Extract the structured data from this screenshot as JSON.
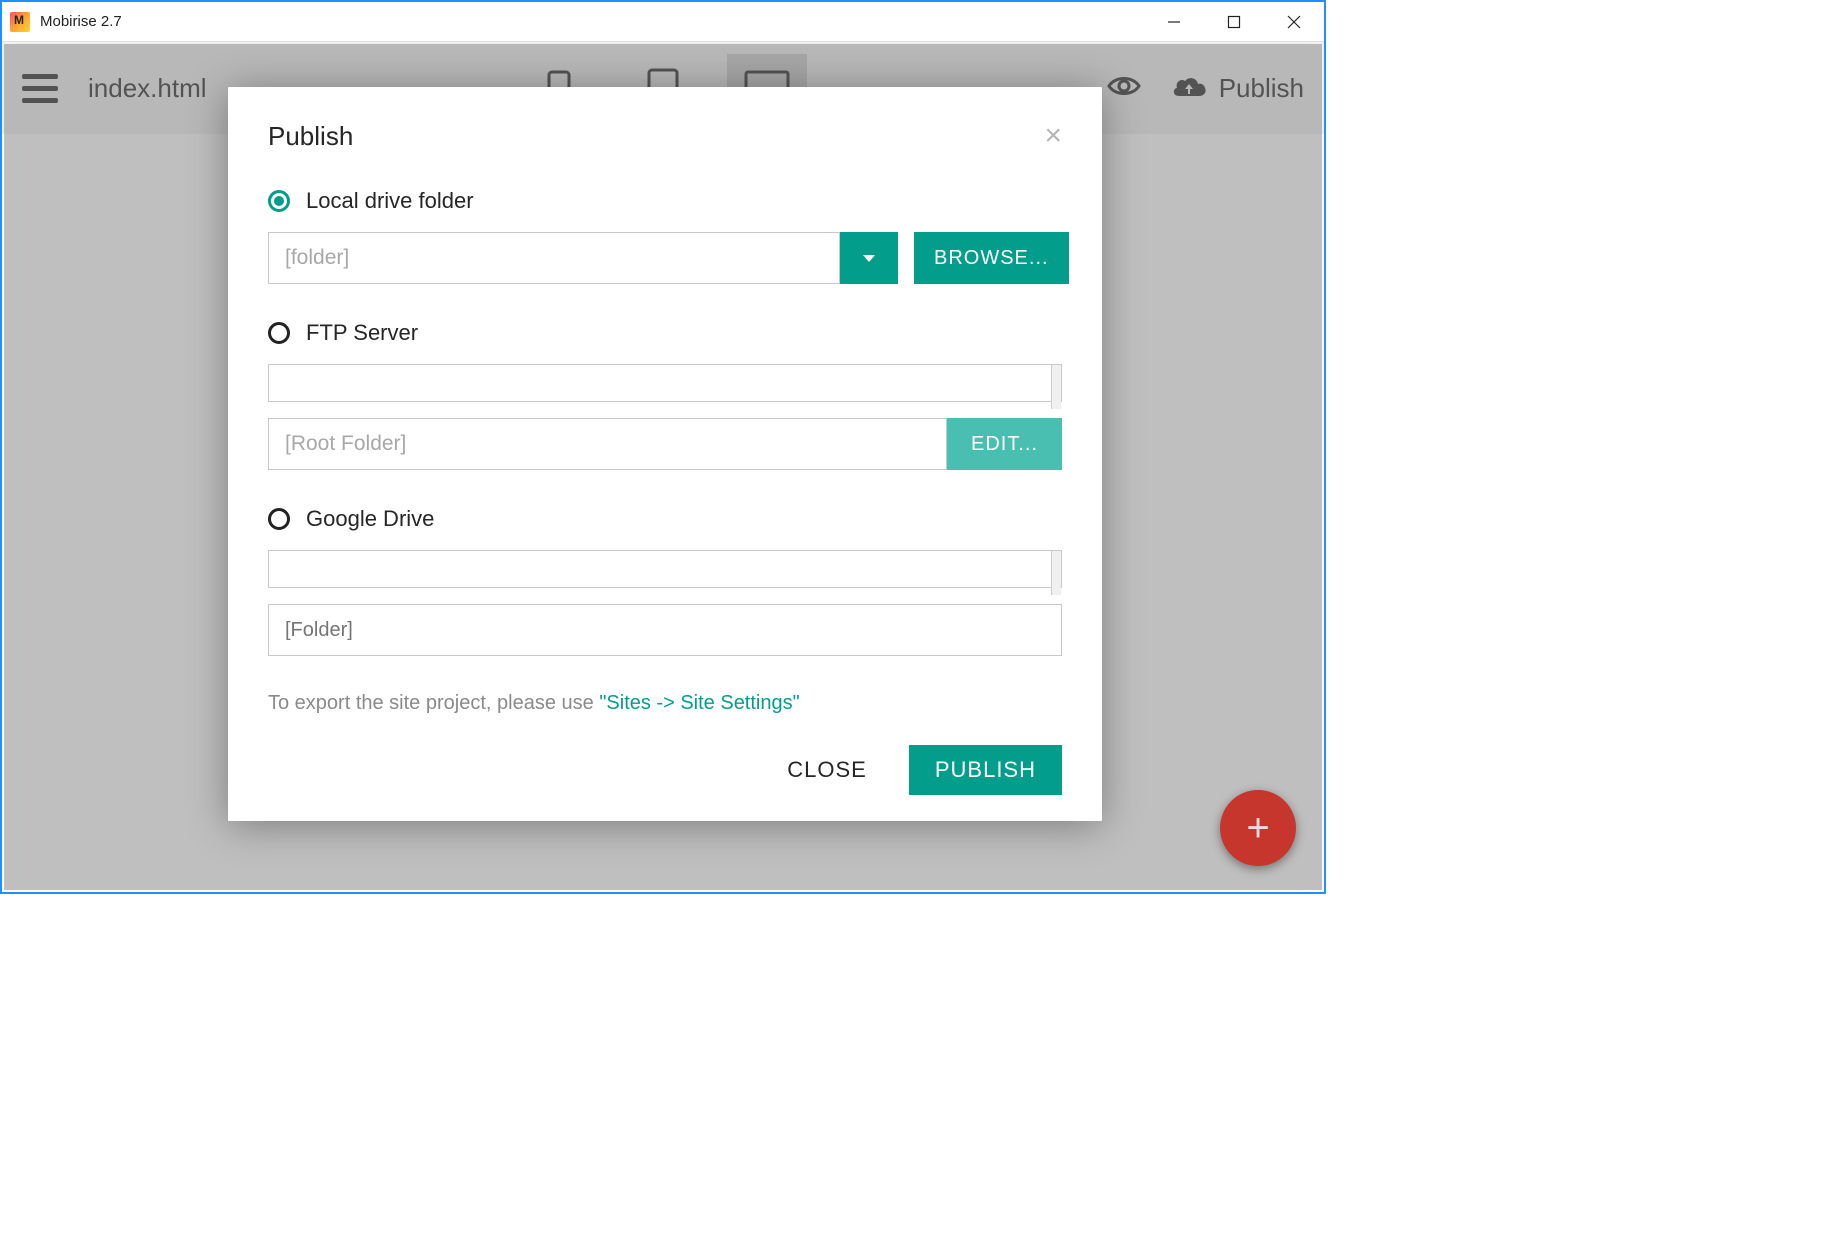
{
  "titlebar": {
    "app_title": "Mobirise 2.7"
  },
  "toolbar": {
    "page_name": "index.html",
    "publish_label": "Publish"
  },
  "modal": {
    "title": "Publish",
    "options": {
      "local": {
        "label": "Local drive folder",
        "placeholder": "[folder]",
        "browse_label": "BROWSE..."
      },
      "ftp": {
        "label": "FTP Server",
        "root_placeholder": "[Root Folder]",
        "edit_label": "EDIT..."
      },
      "gdrive": {
        "label": "Google Drive",
        "folder_placeholder": "[Folder]"
      }
    },
    "hint_prefix": "To export the site project, please use ",
    "hint_link": "\"Sites -> Site Settings\"",
    "close_label": "CLOSE",
    "publish_label": "PUBLISH"
  }
}
